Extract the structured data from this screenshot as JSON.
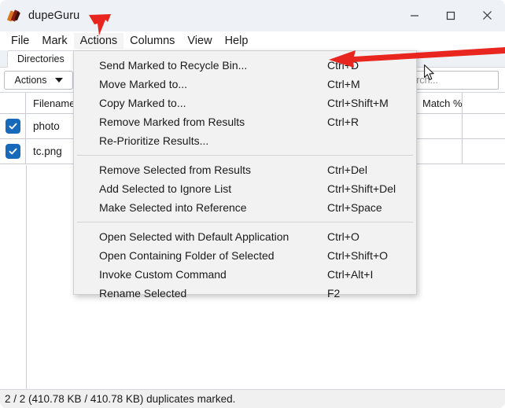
{
  "window": {
    "title": "dupeGuru",
    "icon": "dupeguru-logo-icon",
    "controls": {
      "minimize": "—",
      "maximize": "□",
      "close": "✕"
    }
  },
  "menubar": {
    "items": [
      {
        "label": "File",
        "active": false
      },
      {
        "label": "Mark",
        "active": false
      },
      {
        "label": "Actions",
        "active": true
      },
      {
        "label": "Columns",
        "active": false
      },
      {
        "label": "View",
        "active": false
      },
      {
        "label": "Help",
        "active": false
      }
    ]
  },
  "tabstrip": {
    "tabs": [
      {
        "label": "Directories",
        "selected": true
      }
    ]
  },
  "toolbar": {
    "actions_label": "Actions",
    "actions_caret": "chevron-down-icon",
    "search_placeholder": "Search..."
  },
  "results": {
    "columns": [
      {
        "key": "check",
        "label": ""
      },
      {
        "key": "name",
        "label": "Filename"
      },
      {
        "key": "match",
        "label": "Match %"
      }
    ],
    "rows": [
      {
        "checked": true,
        "name": "photo",
        "match": ""
      },
      {
        "checked": true,
        "name": "tc.png",
        "match": ""
      }
    ]
  },
  "actions_menu": {
    "groups": [
      {
        "items": [
          {
            "label": "Send Marked to Recycle Bin...",
            "accel": "Ctrl+D"
          },
          {
            "label": "Move Marked to...",
            "accel": "Ctrl+M"
          },
          {
            "label": "Copy Marked to...",
            "accel": "Ctrl+Shift+M"
          },
          {
            "label": "Remove Marked from Results",
            "accel": "Ctrl+R"
          },
          {
            "label": "Re-Prioritize Results...",
            "accel": ""
          }
        ]
      },
      {
        "items": [
          {
            "label": "Remove Selected from Results",
            "accel": "Ctrl+Del"
          },
          {
            "label": "Add Selected to Ignore List",
            "accel": "Ctrl+Shift+Del"
          },
          {
            "label": "Make Selected into Reference",
            "accel": "Ctrl+Space"
          }
        ]
      },
      {
        "items": [
          {
            "label": "Open Selected with Default Application",
            "accel": "Ctrl+O"
          },
          {
            "label": "Open Containing Folder of Selected",
            "accel": "Ctrl+Shift+O"
          },
          {
            "label": "Invoke Custom Command",
            "accel": "Ctrl+Alt+I"
          },
          {
            "label": "Rename Selected",
            "accel": "F2"
          }
        ]
      }
    ]
  },
  "annotations": {
    "arrow_color": "#e8251f",
    "arrows": [
      {
        "name": "arrow-pointing-to-actions-menu"
      },
      {
        "name": "arrow-pointing-to-send-marked-shortcut"
      }
    ]
  },
  "statusbar": {
    "text": "2 / 2 (410.78 KB / 410.78 KB) duplicates marked."
  },
  "colors": {
    "accent_checkbox": "#1669bb",
    "titlebar_bg": "#eef1f5",
    "menu_bg": "#f2f2f2",
    "annotation_red": "#e8251f"
  }
}
